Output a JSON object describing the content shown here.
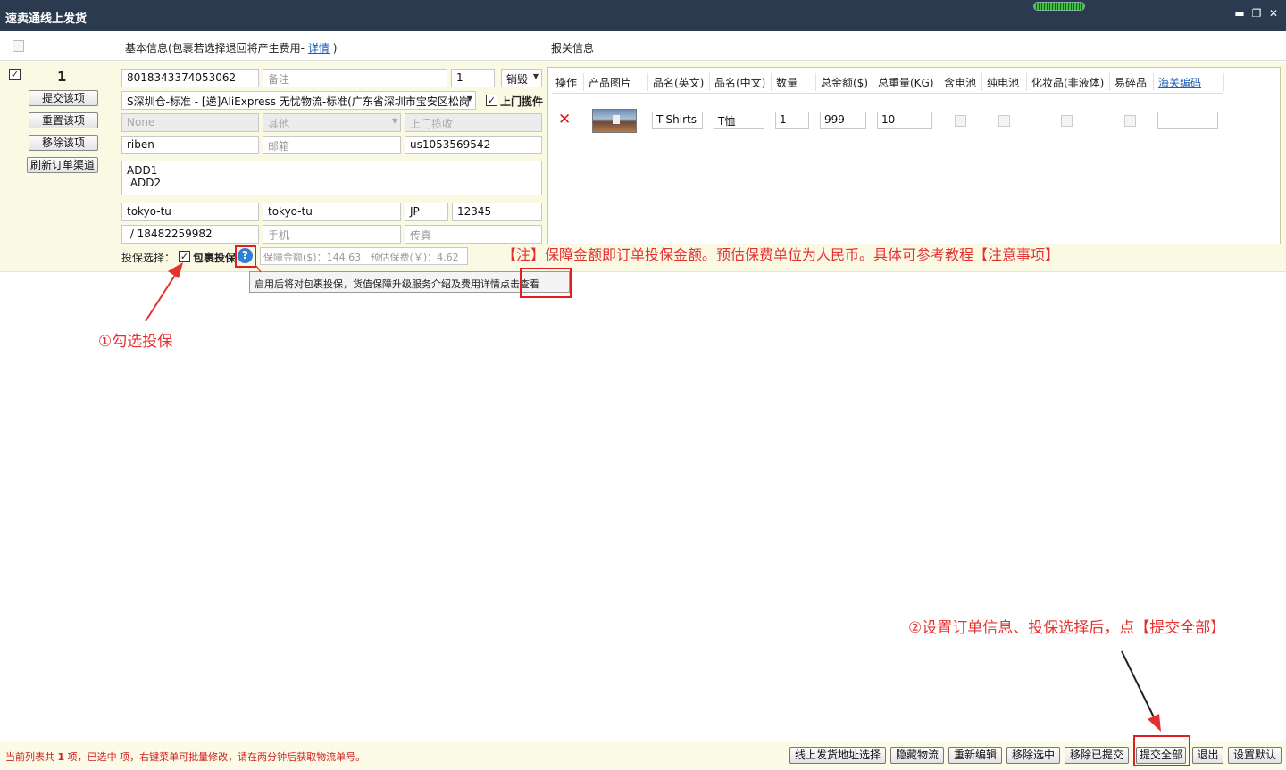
{
  "window": {
    "title": "速卖通线上发货"
  },
  "header": {
    "basic_info": "基本信息(包裹若选择退回将产生费用-",
    "basic_link": "详情",
    "basic_close": ")",
    "customs_info": "报关信息"
  },
  "order": {
    "number": "1",
    "buttons": {
      "submit": "提交该项",
      "reset": "重置该项",
      "remove": "移除该项",
      "refresh": "刷新订单渠道"
    },
    "fields": {
      "order_id": "8018343374053062",
      "remark_placeholder": "备注",
      "qty": "1",
      "action": "销毁",
      "logistics": "S深圳仓-标准 - [递]AliExpress 无忧物流-标准(广东省深圳市宝安区松岗",
      "pickup_label": "上门揽件",
      "none": "None",
      "other": "其他",
      "pickup_collect": "上门揽收",
      "name": "riben",
      "email_placeholder": "邮箱",
      "account": "us1053569542",
      "address1": "ADD1",
      "address2": " ADD2",
      "city": "tokyo-tu",
      "state": "tokyo-tu",
      "country": "JP",
      "zip": "12345",
      "phone": " / 18482259982",
      "mobile_placeholder": "手机",
      "fax_placeholder": "传真"
    },
    "insurance": {
      "label": "投保选择：",
      "checkbox_label": "包裹投保",
      "help": "?",
      "summary": "保障金额($)：144.63   预估保费(￥)：4.62"
    }
  },
  "customs": {
    "columns": [
      "操作",
      "产品图片",
      "品名(英文)",
      "品名(中文)",
      "数量",
      "总金额($)",
      "总重量(KG)",
      "含电池",
      "纯电池",
      "化妆品(非液体)",
      "易碎品",
      "海关编码"
    ],
    "row": {
      "delete_icon": "✕",
      "name_en": "T-Shirts",
      "name_cn": "T恤",
      "qty": "1",
      "amount": "999",
      "weight": "10",
      "hs_code": ""
    }
  },
  "annotations": {
    "note": "【注】保障金额即订单投保金额。预估保费单位为人民币。具体可参考教程【注意事项】",
    "step1": "①勾选投保",
    "step2": "②设置订单信息、投保选择后，点【提交全部】"
  },
  "tooltip": {
    "text": "启用后将对包裹投保，货值保障升级服务介绍及费用详情",
    "link": "点击查看"
  },
  "status": {
    "prefix": "当前列表共 ",
    "count": "1",
    "suffix": " 项，已选中  项，右键菜单可批量修改，请在两分钟后获取物流单号。"
  },
  "footer_buttons": {
    "address_select": "线上发货地址选择",
    "hide_logistics": "隐藏物流",
    "re_edit": "重新编辑",
    "remove_selected": "移除选中",
    "remove_submitted": "移除已提交",
    "submit_all": "提交全部",
    "exit": "退出",
    "set_default": "设置默认"
  },
  "colors": {
    "titlebar": "#2b3a4f",
    "accent_red": "#e53030",
    "link": "#1a5fb4",
    "order_bg": "#fafae4"
  }
}
